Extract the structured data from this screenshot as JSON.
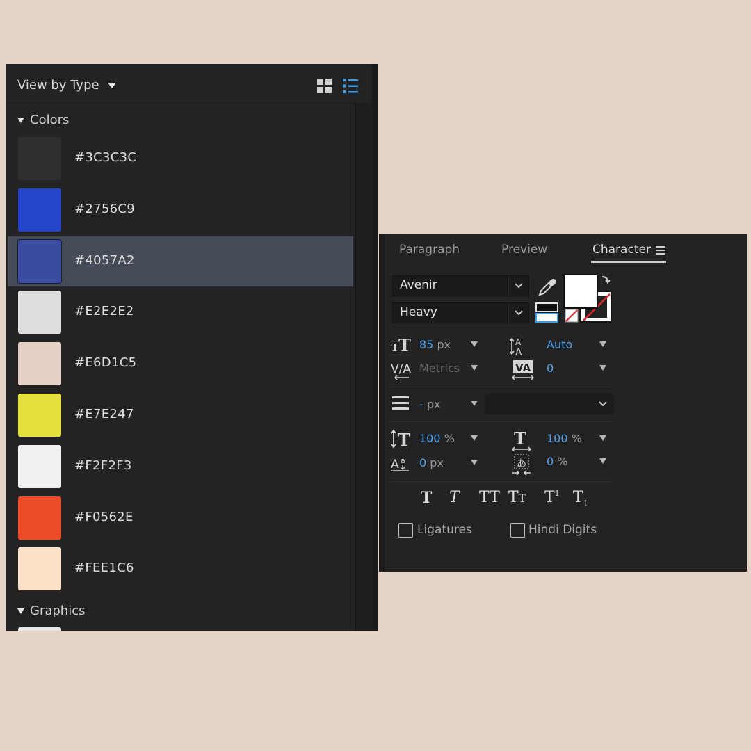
{
  "libraries": {
    "view_label": "View by Type",
    "colors_section": "Colors",
    "graphics_section": "Graphics",
    "swatches": [
      {
        "hex": "#3C3C3C",
        "color": "#2F3030",
        "selected": false
      },
      {
        "hex": "#2756C9",
        "color": "#2447C9",
        "selected": false
      },
      {
        "hex": "#4057A2",
        "color": "#3B4B9F",
        "selected": true
      },
      {
        "hex": "#E2E2E2",
        "color": "#DEDEDE",
        "selected": false
      },
      {
        "hex": "#E6D1C5",
        "color": "#E6D1C5",
        "selected": false
      },
      {
        "hex": "#E7E247",
        "color": "#E5E03D",
        "selected": false
      },
      {
        "hex": "#F2F2F3",
        "color": "#F0F0F0",
        "selected": false
      },
      {
        "hex": "#F0562E",
        "color": "#EE4B28",
        "selected": false
      },
      {
        "hex": "#FEE1C6",
        "color": "#FDE1C7",
        "selected": false
      }
    ],
    "selected_row_color": "#454C57"
  },
  "character": {
    "tabs": [
      "Paragraph",
      "Preview",
      "Character"
    ],
    "active_tab": "Character",
    "font_family": "Avenir",
    "font_style": "Heavy",
    "font_size": {
      "value": "85",
      "unit": "px"
    },
    "leading": {
      "value": "Auto"
    },
    "kerning": {
      "value": "Metrics"
    },
    "tracking": {
      "value": "0"
    },
    "stroke_width": {
      "value": "-",
      "unit": "px"
    },
    "stroke_style": "",
    "vertical_scale": {
      "value": "100",
      "unit": "%"
    },
    "horizontal_scale": {
      "value": "100",
      "unit": "%"
    },
    "baseline_shift": {
      "value": "0",
      "unit": "px"
    },
    "tsume": {
      "value": "0",
      "unit": "%"
    },
    "ligatures_label": "Ligatures",
    "hindi_digits_label": "Hindi Digits",
    "ligatures_checked": false,
    "hindi_digits_checked": false,
    "accent_color": "#4EA5F1",
    "fill_color": "#FFFFFF"
  }
}
